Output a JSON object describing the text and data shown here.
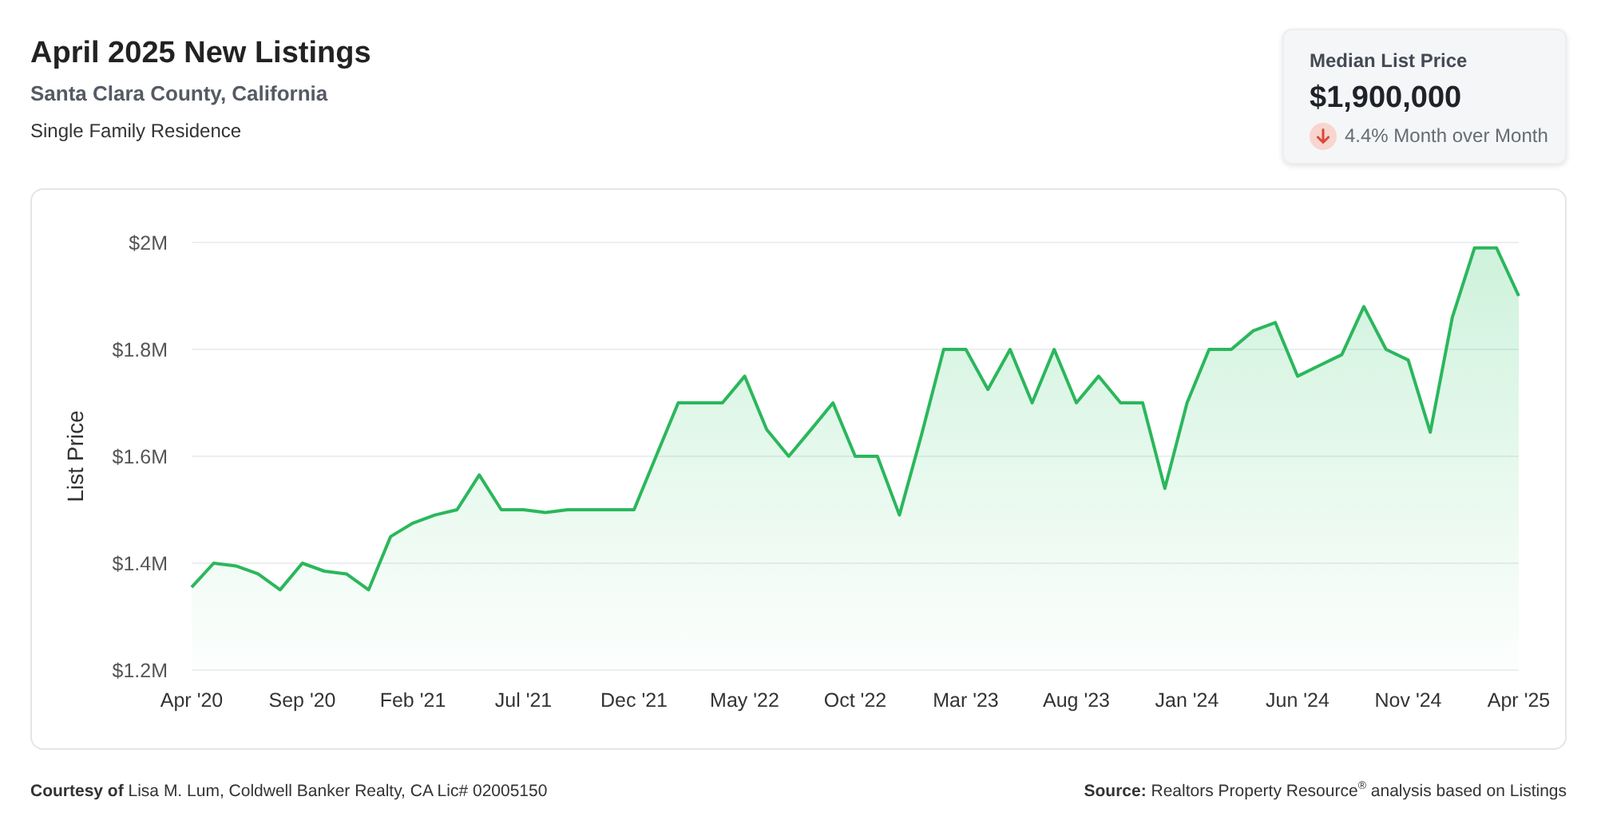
{
  "header": {
    "title": "April 2025 New Listings",
    "subtitle": "Santa Clara County, California",
    "property_type": "Single Family Residence"
  },
  "summary_card": {
    "label": "Median List Price",
    "value": "$1,900,000",
    "decreased": true,
    "change": "4.4% Month over Month"
  },
  "chart": {
    "chart_data": {
      "type": "area",
      "ylabel": "List Price",
      "grid": true,
      "categories": [
        "Apr '20",
        null,
        null,
        null,
        null,
        "Sep '20",
        null,
        null,
        null,
        null,
        "Feb '21",
        null,
        null,
        null,
        null,
        "Jul '21",
        null,
        null,
        null,
        null,
        "Dec '21",
        null,
        null,
        null,
        null,
        "May '22",
        null,
        null,
        null,
        null,
        "Oct '22",
        null,
        null,
        null,
        null,
        "Mar '23",
        null,
        null,
        null,
        null,
        "Aug '23",
        null,
        null,
        null,
        null,
        "Jan '24",
        null,
        null,
        null,
        null,
        "Jun '24",
        null,
        null,
        null,
        null,
        "Nov '24",
        null,
        null,
        null,
        null,
        "Apr '25"
      ],
      "values": [
        1.355,
        1.4,
        1.395,
        1.38,
        1.35,
        1.4,
        1.385,
        1.38,
        1.35,
        1.45,
        1.475,
        1.49,
        1.5,
        1.565,
        1.5,
        1.5,
        1.495,
        1.5,
        1.5,
        1.5,
        1.5,
        1.6,
        1.7,
        1.7,
        1.7,
        1.75,
        1.65,
        1.6,
        1.65,
        1.7,
        1.6,
        1.6,
        1.49,
        1.64,
        1.8,
        1.8,
        1.725,
        1.8,
        1.7,
        1.8,
        1.7,
        1.75,
        1.7,
        1.7,
        1.54,
        1.7,
        1.8,
        1.8,
        1.835,
        1.85,
        1.75,
        1.77,
        1.79,
        1.88,
        1.8,
        1.78,
        1.645,
        1.86,
        1.99,
        1.99,
        1.9
      ],
      "ylim": [
        1.2,
        2.0
      ],
      "yticks": [
        {
          "value": 1.2,
          "label": "$1.2M"
        },
        {
          "value": 1.4,
          "label": "$1.4M"
        },
        {
          "value": 1.6,
          "label": "$1.6M"
        },
        {
          "value": 1.8,
          "label": "$1.8M"
        },
        {
          "value": 2.0,
          "label": "$2M"
        }
      ]
    }
  },
  "footer": {
    "credit": "**Courtesy of** Lisa M. Lum, Coldwell Banker Realty, CA Lic# 02005150",
    "source": "**Source:** Realtors Property Resource$^{®}$ analysis based on Listings"
  }
}
